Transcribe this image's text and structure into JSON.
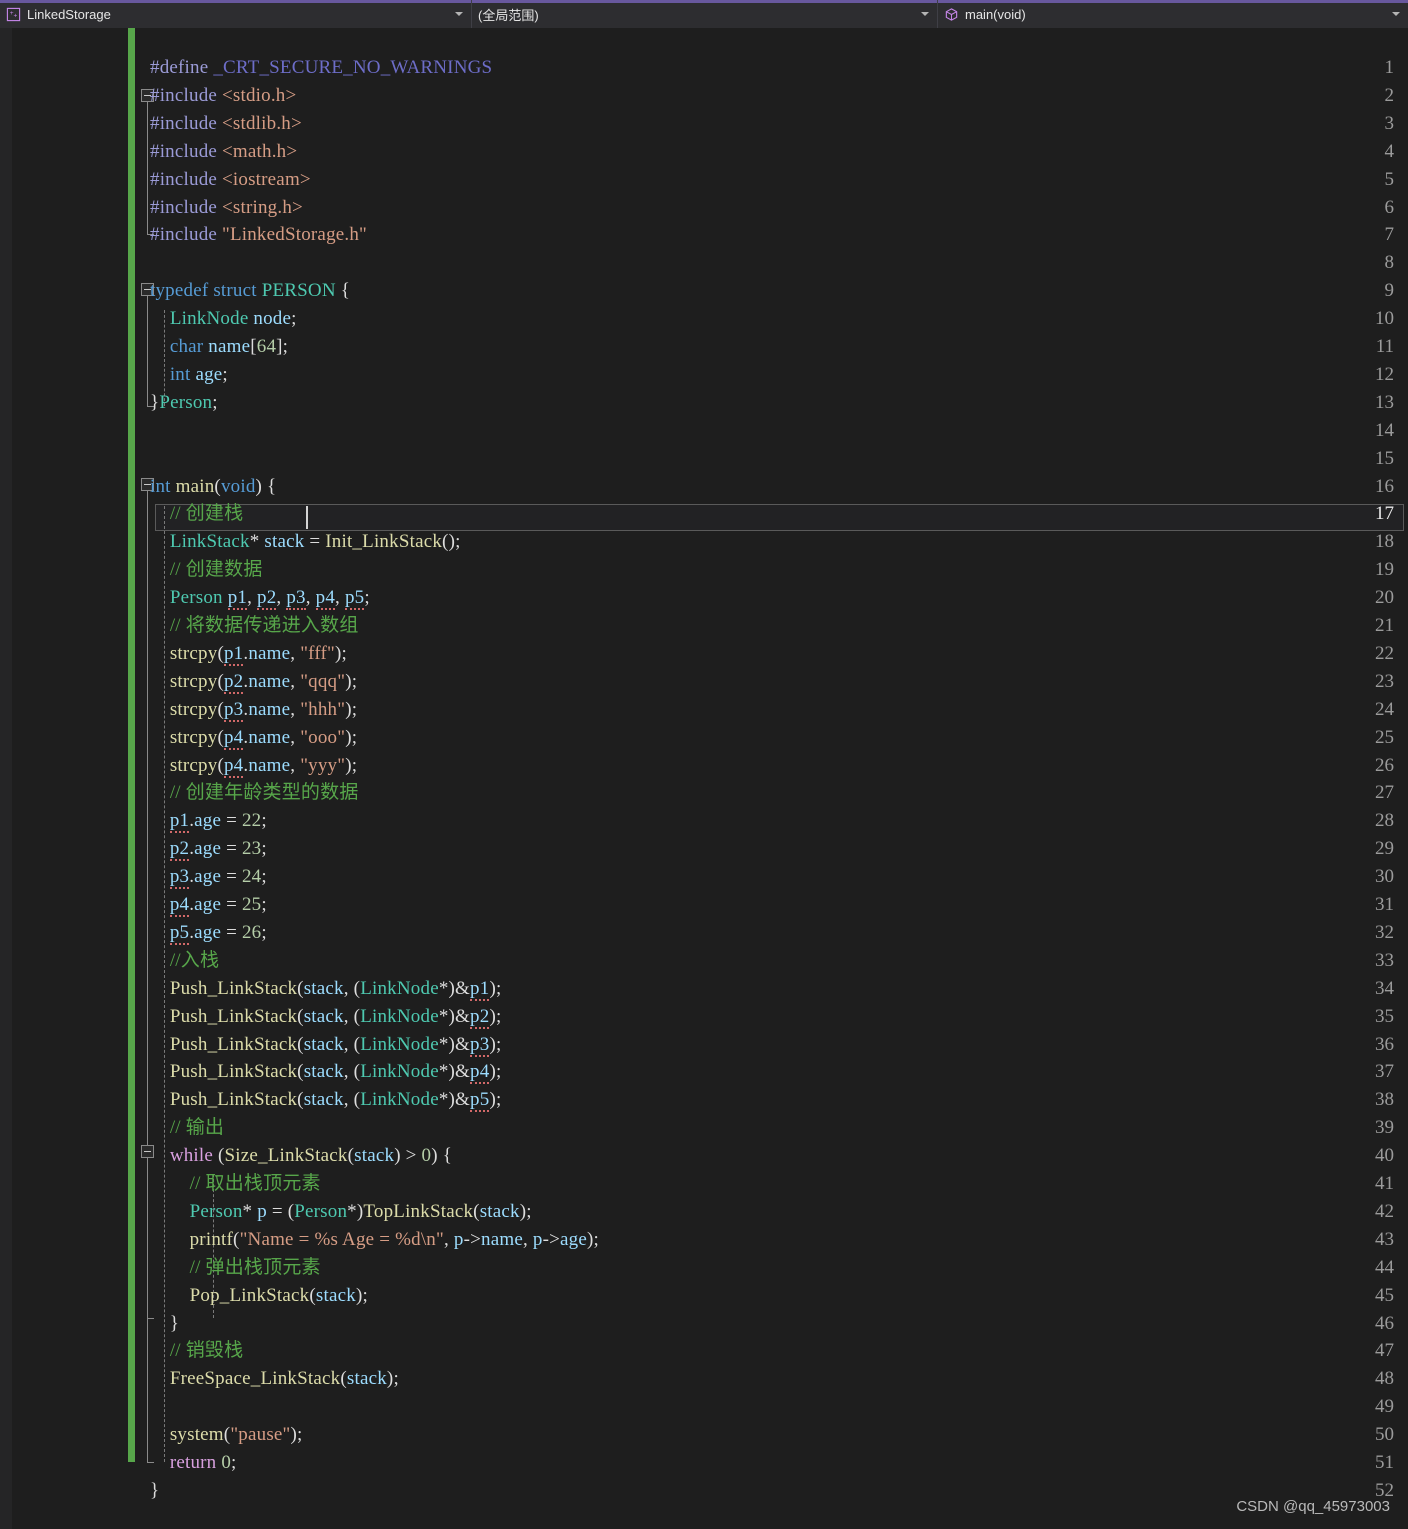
{
  "navbar": {
    "project": {
      "label": "LinkedStorage",
      "icon": "cpp-file-icon"
    },
    "scope": {
      "label": "(全局范围)"
    },
    "member": {
      "label": "main(void)",
      "icon": "method-cube-icon"
    },
    "accent_color": "#68589e",
    "background_color": "#2d2d30"
  },
  "editor": {
    "background_color": "#1e1e1e",
    "change_bar_color": "#57a64a",
    "current_line": 17,
    "first_line": 1,
    "last_line": 52,
    "line_numbers": [
      "1",
      "2",
      "3",
      "4",
      "5",
      "6",
      "7",
      "8",
      "9",
      "10",
      "11",
      "12",
      "13",
      "14",
      "15",
      "16",
      "17",
      "18",
      "19",
      "20",
      "21",
      "22",
      "23",
      "24",
      "25",
      "26",
      "27",
      "28",
      "29",
      "30",
      "31",
      "32",
      "33",
      "34",
      "35",
      "36",
      "37",
      "38",
      "39",
      "40",
      "41",
      "42",
      "43",
      "44",
      "45",
      "46",
      "47",
      "48",
      "49",
      "50",
      "51",
      "52"
    ],
    "code": [
      "#define _CRT_SECURE_NO_WARNINGS",
      "#include <stdio.h>",
      "#include <stdlib.h>",
      "#include <math.h>",
      "#include <iostream>",
      "#include <string.h>",
      "#include \"LinkedStorage.h\"",
      "",
      "typedef struct PERSON {",
      "    LinkNode node;",
      "    char name[64];",
      "    int age;",
      "}Person;",
      "",
      "",
      "int main(void) {",
      "    // 创建栈",
      "    LinkStack* stack = Init_LinkStack();",
      "    // 创建数据",
      "    Person p1, p2, p3, p4, p5;",
      "    // 将数据传递进入数组",
      "    strcpy(p1.name, \"fff\");",
      "    strcpy(p2.name, \"qqq\");",
      "    strcpy(p3.name, \"hhh\");",
      "    strcpy(p4.name, \"ooo\");",
      "    strcpy(p4.name, \"yyy\");",
      "    // 创建年龄类型的数据",
      "    p1.age = 22;",
      "    p2.age = 23;",
      "    p3.age = 24;",
      "    p4.age = 25;",
      "    p5.age = 26;",
      "    //入栈",
      "    Push_LinkStack(stack, (LinkNode*)&p1);",
      "    Push_LinkStack(stack, (LinkNode*)&p2);",
      "    Push_LinkStack(stack, (LinkNode*)&p3);",
      "    Push_LinkStack(stack, (LinkNode*)&p4);",
      "    Push_LinkStack(stack, (LinkNode*)&p5);",
      "    // 输出",
      "    while (Size_LinkStack(stack) > 0) {",
      "        // 取出栈顶元素",
      "        Person* p = (Person*)TopLinkStack(stack);",
      "        printf(\"Name = %s Age = %d\\n\", p->name, p->age);",
      "        // 弹出栈顶元素",
      "        Pop_LinkStack(stack);",
      "    }",
      "    // 销毁栈",
      "    FreeSpace_LinkStack(stack);",
      "",
      "    system(\"pause\");",
      "    return 0;",
      "}"
    ],
    "fold_markers": [
      {
        "line": 2,
        "state": "expanded"
      },
      {
        "line": 9,
        "state": "expanded"
      },
      {
        "line": 16,
        "state": "expanded"
      },
      {
        "line": 40,
        "state": "expanded"
      }
    ],
    "syntax_colors": {
      "comment": "#57a64a",
      "string": "#d69d85",
      "keyword": "#569cd6",
      "control_keyword": "#d8a0df",
      "type": "#4ec9b0",
      "function": "#dcdcaa",
      "variable": "#9cdcfe",
      "number": "#b5cea8",
      "preprocessor": "#9b9bd7",
      "error_squiggle": "#d16969"
    }
  },
  "watermark": {
    "text": "CSDN @qq_45973003"
  }
}
